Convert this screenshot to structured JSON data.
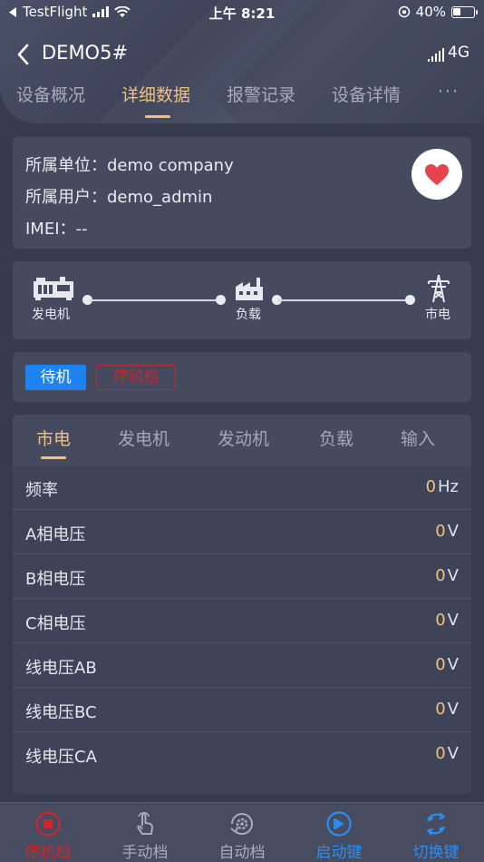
{
  "status_bar": {
    "back_app": "TestFlight",
    "time": "上午 8:21",
    "battery": "40%",
    "battery_level": 0.4
  },
  "nav": {
    "title": "DEMO5#",
    "network": "4G"
  },
  "tabs": [
    {
      "label": "设备概况",
      "active": false
    },
    {
      "label": "详细数据",
      "active": true
    },
    {
      "label": "报警记录",
      "active": false
    },
    {
      "label": "设备详情",
      "active": false
    },
    {
      "label": "···",
      "active": false
    }
  ],
  "info": {
    "unit_label": "所属单位：",
    "unit_value": "demo company",
    "user_label": "所属用户：",
    "user_value": "demo_admin",
    "imei_label": "IMEI：",
    "imei_value": "--"
  },
  "flow": {
    "generator": "发电机",
    "load": "负载",
    "grid": "市电"
  },
  "state": {
    "standby": "待机",
    "stop_gear": "停机档"
  },
  "sub_tabs": [
    {
      "label": "市电",
      "active": true
    },
    {
      "label": "发电机",
      "active": false
    },
    {
      "label": "发动机",
      "active": false
    },
    {
      "label": "负载",
      "active": false
    },
    {
      "label": "输入",
      "active": false
    }
  ],
  "rows": [
    {
      "label": "频率",
      "value": "0",
      "unit": "Hz"
    },
    {
      "label": "A相电压",
      "value": "0",
      "unit": "V"
    },
    {
      "label": "B相电压",
      "value": "0",
      "unit": "V"
    },
    {
      "label": "C相电压",
      "value": "0",
      "unit": "V"
    },
    {
      "label": "线电压AB",
      "value": "0",
      "unit": "V"
    },
    {
      "label": "线电压BC",
      "value": "0",
      "unit": "V"
    },
    {
      "label": "线电压CA",
      "value": "0",
      "unit": "V"
    }
  ],
  "bottom_bar": [
    {
      "label": "停机档",
      "icon": "stop-icon",
      "color": "#d0242f"
    },
    {
      "label": "手动档",
      "icon": "hand-pointer-icon",
      "color": "#a7abba"
    },
    {
      "label": "自动档",
      "icon": "auto-gear-icon",
      "color": "#a7abba"
    },
    {
      "label": "启动键",
      "icon": "play-icon",
      "color": "#2a8ef2"
    },
    {
      "label": "切换键",
      "icon": "switch-icon",
      "color": "#2a8ef2"
    }
  ],
  "colors": {
    "accent_gold": "#efc27a",
    "primary_blue": "#1e83f0",
    "danger_red": "#c02633",
    "background": "#363b4f",
    "card": "#454a5f"
  }
}
